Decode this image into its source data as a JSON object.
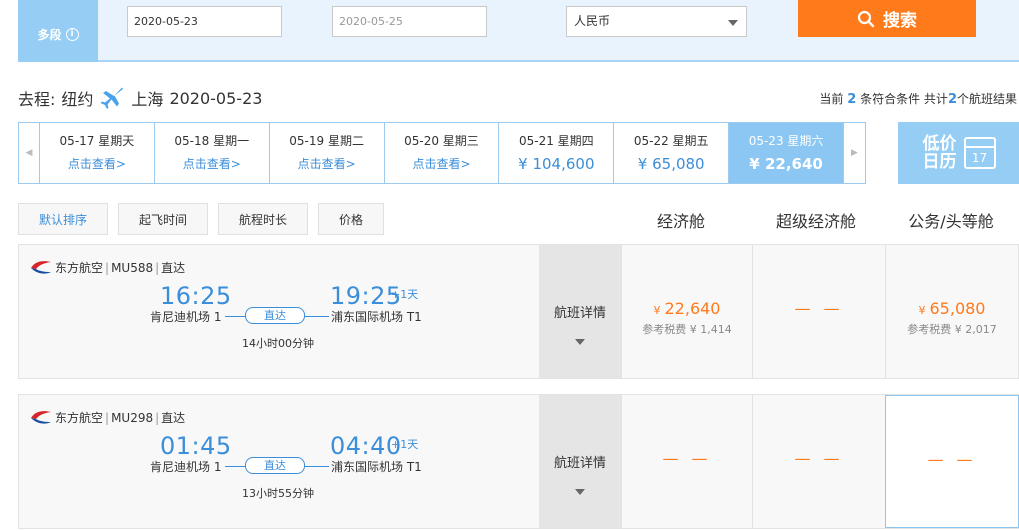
{
  "search": {
    "multi_trip_label": "多段",
    "info_icon": "i",
    "depart_date": "2020-05-23",
    "return_date": "2020-05-25",
    "currency": "人民币",
    "search_button": "搜索"
  },
  "route": {
    "prefix": "去程:",
    "origin": "纽约",
    "destination": "上海",
    "date": "2020-05-23"
  },
  "summary": {
    "text1": "当前",
    "matching": "2",
    "text2": "条符合条件 共计",
    "total": "2",
    "text3": "个航班结果"
  },
  "date_strip": [
    {
      "date": "05-17 星期天",
      "price": "点击查看>",
      "active": false
    },
    {
      "date": "05-18 星期一",
      "price": "点击查看>",
      "active": false
    },
    {
      "date": "05-19 星期二",
      "price": "点击查看>",
      "active": false
    },
    {
      "date": "05-20 星期三",
      "price": "点击查看>",
      "active": false
    },
    {
      "date": "05-21 星期四",
      "price": "¥ 104,600",
      "active": false
    },
    {
      "date": "05-22 星期五",
      "price": "¥ 65,080",
      "active": false
    },
    {
      "date": "05-23 星期六",
      "price": "¥ 22,640",
      "active": true
    }
  ],
  "low_price_calendar": {
    "label": "低价日历",
    "day": "17"
  },
  "sort": {
    "default": "默认排序",
    "departure": "起飞时间",
    "duration": "航程时长",
    "price": "价格"
  },
  "cabins": {
    "economy": "经济舱",
    "premium": "超级经济舱",
    "business": "公务/头等舱"
  },
  "flights": [
    {
      "airline": "东方航空",
      "flight_no": "MU588",
      "type": "直达",
      "dep_time": "16:25",
      "arr_time": "19:25",
      "plus_day": "+1天",
      "dep_airport": "肯尼迪机场 1",
      "arr_airport": "浦东国际机场 T1",
      "direct_tag": "直达",
      "duration": "14小时00分钟",
      "detail": "航班详情",
      "economy": {
        "price": "22,640",
        "tax": "参考税费 ¥ 1,414"
      },
      "premium": "— —",
      "business": {
        "price": "65,080",
        "tax": "参考税费 ¥ 2,017"
      }
    },
    {
      "airline": "东方航空",
      "flight_no": "MU298",
      "type": "直达",
      "dep_time": "01:45",
      "arr_time": "04:40",
      "plus_day": "+1天",
      "dep_airport": "肯尼迪机场 1",
      "arr_airport": "浦东国际机场 T1",
      "direct_tag": "直达",
      "duration": "13小时55分钟",
      "detail": "航班详情",
      "economy": "— —",
      "premium": "— —",
      "business": "— —"
    }
  ],
  "currency_symbol": "¥",
  "separator": "|",
  "colors": {
    "accent_blue": "#3b8ed9",
    "orange": "#ff7a1a",
    "light_blue": "#95cdf5"
  }
}
